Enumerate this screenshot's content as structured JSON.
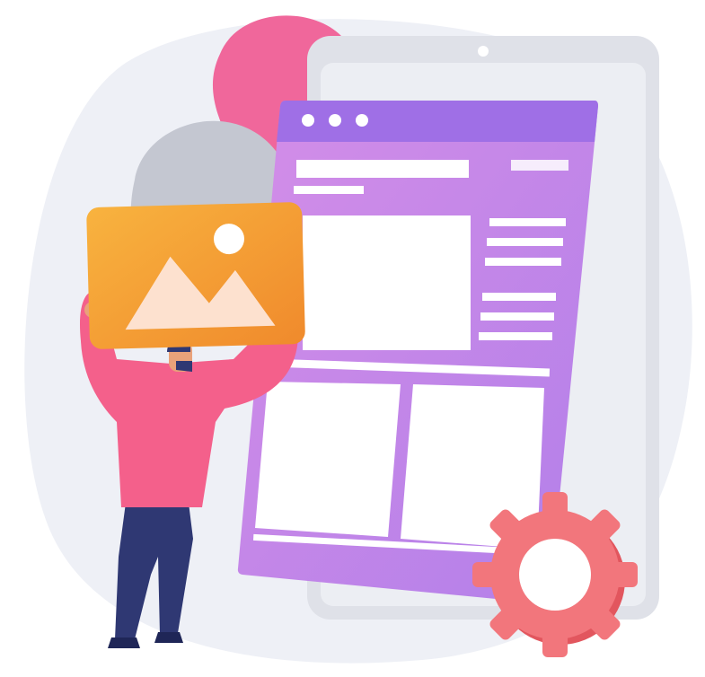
{
  "illustration": {
    "subject": "person-carrying-image-to-web-layout",
    "icons": [
      "image-icon",
      "gear-icon"
    ]
  },
  "palette": {
    "background_blob": "#eef0f6",
    "pink_blob": "#f0679b",
    "gray_blob": "#c4c7d1",
    "tablet_frame": "#dfe1e8",
    "tablet_screen": "#eceef3",
    "window_purple": "#c68ae6",
    "window_header": "#9f6fe6",
    "panel_white": "#ffffff",
    "image_orange": "#f6a93b",
    "shirt_pink": "#f4608b",
    "pants_navy": "#2f3873",
    "gear_pink": "#f2767c"
  },
  "window": {
    "title_bar_dots": 3
  }
}
